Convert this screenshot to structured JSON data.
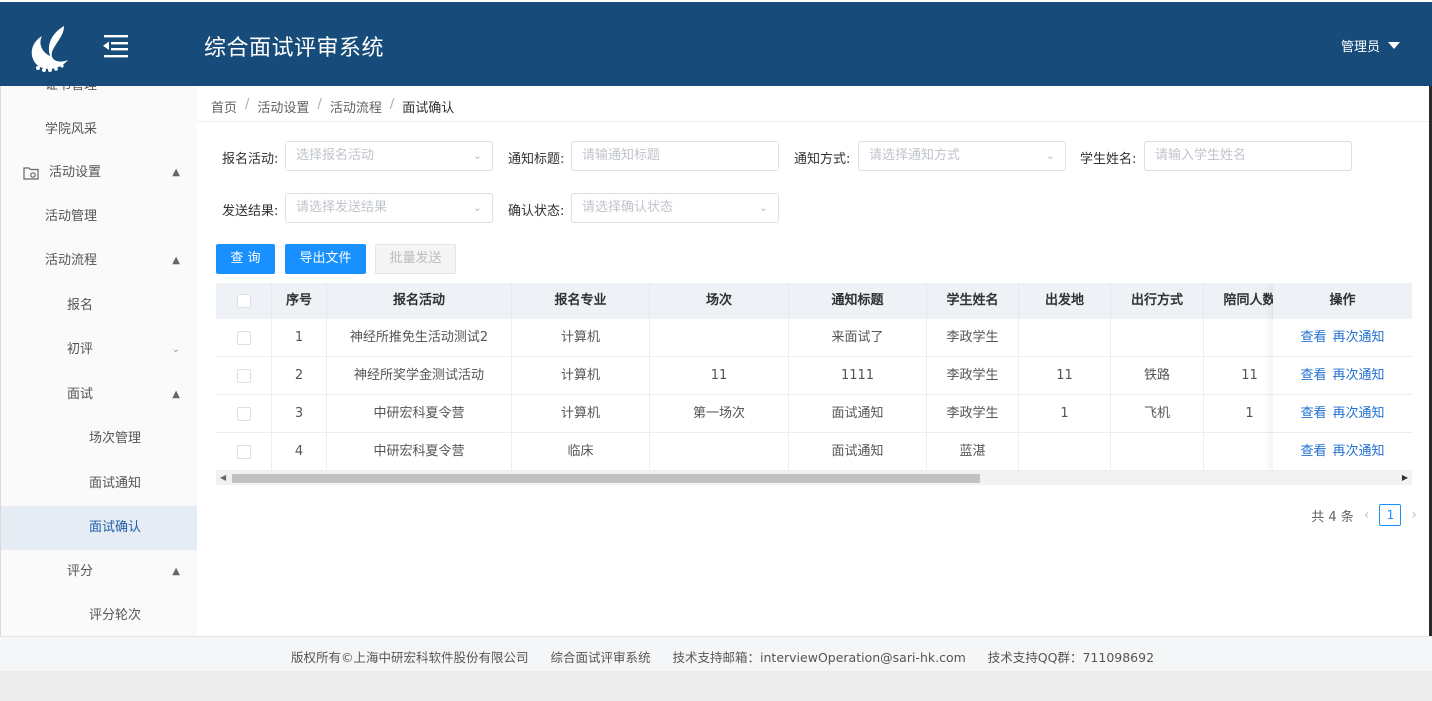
{
  "header": {
    "title": "综合面试评审系统",
    "user": "管理员"
  },
  "sidebar": {
    "items": [
      {
        "label": "证书管理"
      },
      {
        "label": "学院风采"
      },
      {
        "label": "活动设置"
      },
      {
        "label": "活动管理"
      },
      {
        "label": "活动流程"
      },
      {
        "label": "报名"
      },
      {
        "label": "初评"
      },
      {
        "label": "面试"
      },
      {
        "label": "场次管理"
      },
      {
        "label": "面试通知"
      },
      {
        "label": "面试确认"
      },
      {
        "label": "评分"
      },
      {
        "label": "评分轮次"
      }
    ]
  },
  "breadcrumb": [
    "首页",
    "活动设置",
    "活动流程",
    "面试确认"
  ],
  "filters": {
    "activity": {
      "label": "报名活动:",
      "placeholder": "选择报名活动"
    },
    "notice_title": {
      "label": "通知标题:",
      "placeholder": "请输通知标题"
    },
    "notice_method": {
      "label": "通知方式:",
      "placeholder": "请选择通知方式"
    },
    "student_name": {
      "label": "学生姓名:",
      "placeholder": "请输入学生姓名"
    },
    "send_result": {
      "label": "发送结果:",
      "placeholder": "请选择发送结果"
    },
    "confirm_status": {
      "label": "确认状态:",
      "placeholder": "请选择确认状态"
    }
  },
  "buttons": {
    "query": "查 询",
    "export": "导出文件",
    "batch_send": "批量发送"
  },
  "table": {
    "columns": [
      "序号",
      "报名活动",
      "报名专业",
      "场次",
      "通知标题",
      "学生姓名",
      "出发地",
      "出行方式",
      "陪同人数",
      "操作"
    ],
    "rows": [
      {
        "no": "1",
        "activity": "神经所推免生活动测试2",
        "major": "计算机",
        "session": "",
        "title": "来面试了",
        "student": "李政学生",
        "origin": "",
        "travel": "",
        "companions": ""
      },
      {
        "no": "2",
        "activity": "神经所奖学金测试活动",
        "major": "计算机",
        "session": "11",
        "title": "1111",
        "student": "李政学生",
        "origin": "11",
        "travel": "铁路",
        "companions": "11"
      },
      {
        "no": "3",
        "activity": "中研宏科夏令营",
        "major": "计算机",
        "session": "第一场次",
        "title": "面试通知",
        "student": "李政学生",
        "origin": "1",
        "travel": "飞机",
        "companions": "1"
      },
      {
        "no": "4",
        "activity": "中研宏科夏令营",
        "major": "临床",
        "session": "",
        "title": "面试通知",
        "student": "蓝湛",
        "origin": "",
        "travel": "",
        "companions": ""
      }
    ],
    "actions": {
      "view": "查看",
      "renotify": "再次通知"
    }
  },
  "pagination": {
    "total": "共 4 条",
    "current": "1"
  },
  "footer": {
    "copyright": "版权所有©上海中研宏科软件股份有限公司",
    "system": "综合面试评审系统",
    "email": "技术支持邮箱：interviewOperation@sari-hk.com",
    "qq": "技术支持QQ群：711098692"
  },
  "colors": {
    "header_bg": "#174c7a",
    "primary": "#1890ff",
    "link": "#1f6fd1"
  }
}
